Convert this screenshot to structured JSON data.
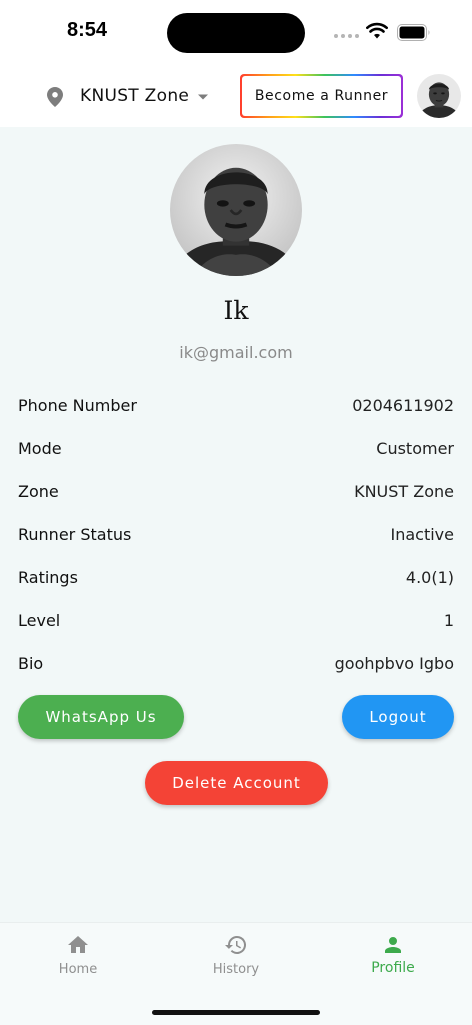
{
  "status_bar": {
    "time": "8:54"
  },
  "header": {
    "zone": "KNUST Zone",
    "become_runner_label": "Become a Runner"
  },
  "profile": {
    "name": "Ik",
    "email": "ik@gmail.com"
  },
  "details": [
    {
      "label": "Phone Number",
      "value": "0204611902"
    },
    {
      "label": "Mode",
      "value": "Customer"
    },
    {
      "label": "Zone",
      "value": "KNUST Zone"
    },
    {
      "label": "Runner Status",
      "value": "Inactive"
    },
    {
      "label": "Ratings",
      "value": "4.0(1)"
    },
    {
      "label": "Level",
      "value": "1"
    },
    {
      "label": "Bio",
      "value": "goohpbvo Igbo"
    }
  ],
  "actions": {
    "whatsapp_label": "WhatsApp Us",
    "logout_label": "Logout",
    "delete_label": "Delete Account"
  },
  "bottom_nav": {
    "items": [
      {
        "label": "Home",
        "icon": "home-icon",
        "active": false
      },
      {
        "label": "History",
        "icon": "history-icon",
        "active": false
      },
      {
        "label": "Profile",
        "icon": "person-icon",
        "active": true
      }
    ]
  },
  "colors": {
    "whatsapp": "#4caf50",
    "logout": "#2196f3",
    "delete": "#f44336",
    "nav_active": "#3daa4c"
  }
}
